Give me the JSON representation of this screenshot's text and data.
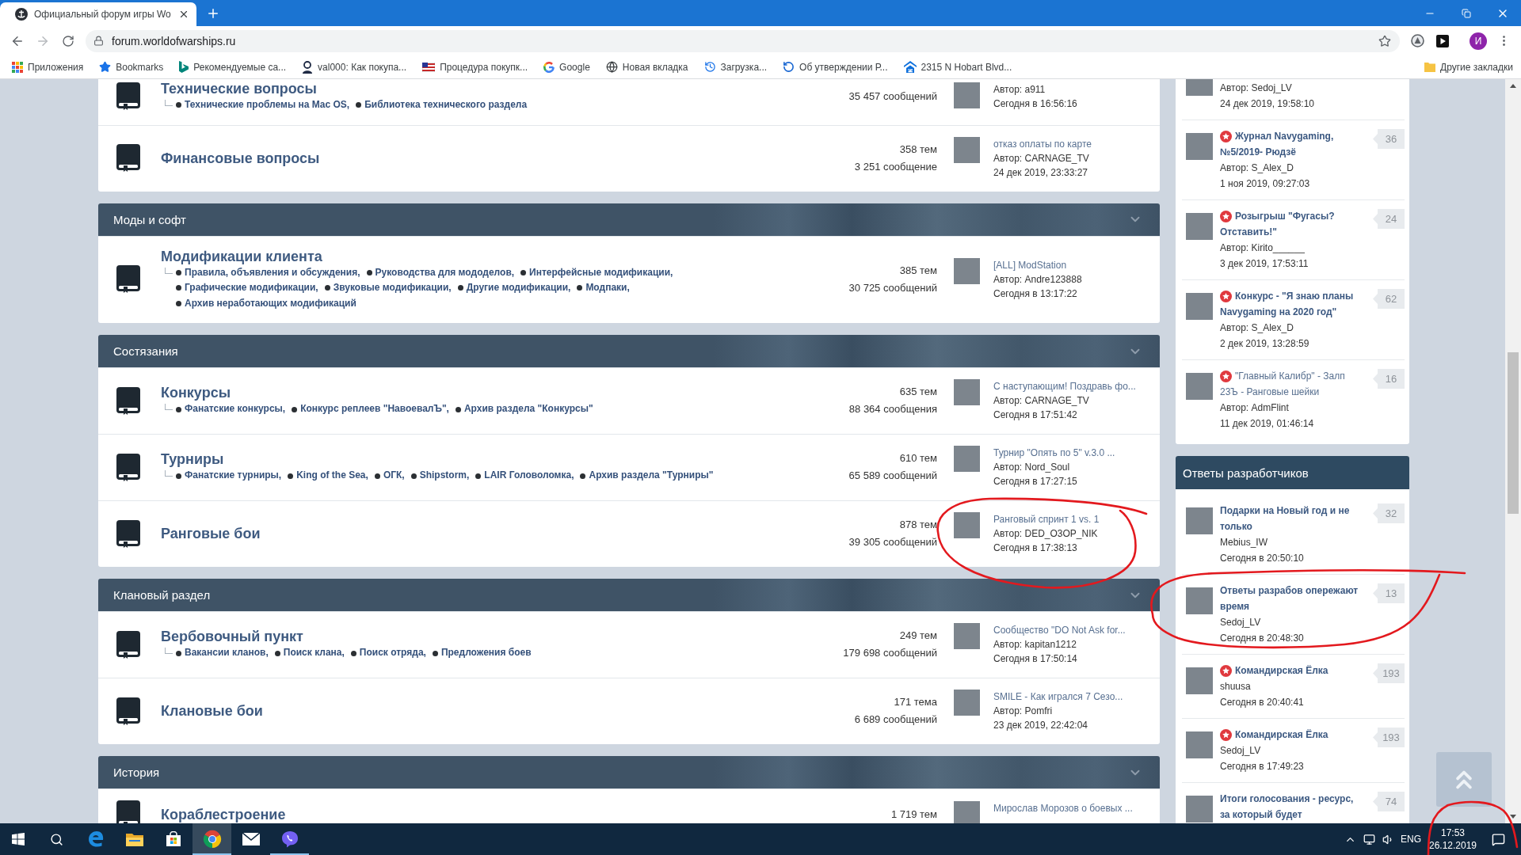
{
  "browser": {
    "tabs": [
      {
        "title": "Официальный форум игры Wo",
        "selected": true
      }
    ],
    "navigation": {
      "back_disabled": false,
      "forward_disabled": true
    },
    "address": "forum.worldofwarships.ru",
    "profile_initial": "И",
    "bookmarks": [
      {
        "label": "Приложения",
        "kind": "grid"
      },
      {
        "label": "Bookmarks",
        "kind": "star"
      },
      {
        "label": "Рекомендуемые са...",
        "kind": "logo"
      },
      {
        "label": "val000: Как покупа...",
        "kind": "person"
      },
      {
        "label": "Процедура покупк...",
        "kind": "flag"
      },
      {
        "label": "Google",
        "kind": "ring"
      },
      {
        "label": "Новая вкладка",
        "kind": "globe"
      },
      {
        "label": "Загрузка...",
        "kind": "history"
      },
      {
        "label": "Об утверждении Р...",
        "kind": "arc"
      },
      {
        "label": "2315 N Hobart Blvd...",
        "kind": "house"
      }
    ],
    "other_bookmarks": "Другие закладки"
  },
  "forum": {
    "sections": [
      {
        "forums": [
          {
            "title": "Технические вопросы",
            "subforums": [
              "Технические проблемы на Mac OS,",
              "Библиотека технического раздела"
            ],
            "posts": "35 457 сообщений",
            "last_post": {
              "author": "Автор: a911",
              "date": "Сегодня в 16:56:16",
              "circled": false
            }
          },
          {
            "title": "Финансовые вопросы",
            "topics": "358 тем",
            "posts": "3 251 сообщение",
            "last_post": {
              "topic": "отказ оплаты по карте",
              "author": "Автор: CARNAGE_TV",
              "date": "24 дек 2019, 23:33:27",
              "circled": false
            }
          }
        ]
      },
      {
        "title": "Моды и софт",
        "forums": [
          {
            "title": "Модификации клиента",
            "subforums": [
              "Правила, объявления и обсуждения,",
              "Руководства для мододелов,",
              "Интерфейсные модификации,",
              "Графические модификации,",
              "Звуковые модификации,",
              "Другие модификации,",
              "Модпаки,",
              "Архив неработающих модификаций"
            ],
            "topics": "385 тем",
            "posts": "30 725 сообщений",
            "last_post": {
              "topic": "[ALL] ModStation",
              "author": "Автор: Andre123888",
              "date": "Сегодня в 13:17:22",
              "circled": false
            }
          }
        ]
      },
      {
        "title": "Состязания",
        "forums": [
          {
            "title": "Конкурсы",
            "subforums": [
              "Фанатские конкурсы,",
              "Конкурс реплеев \"НавоевалЪ\",",
              "Архив раздела \"Конкурсы\""
            ],
            "topics": "635 тем",
            "posts": "88 364 сообщения",
            "last_post": {
              "topic": "С наступающим! Поздравь фо...",
              "author": "Автор: CARNAGE_TV",
              "date": "Сегодня в 17:51:42",
              "circled": false
            }
          },
          {
            "title": "Турниры",
            "subforums": [
              "Фанатские турниры,",
              "King of the Sea,",
              "ОГК,",
              "Shipstorm,",
              "LAIR Головоломка,",
              "Архив раздела \"Турниры\""
            ],
            "topics": "610 тем",
            "posts": "65 589 сообщений",
            "last_post": {
              "topic": "Турнир \"Опять по 5\" v.3.0 ...",
              "author": "Автор: Nord_Soul",
              "date": "Сегодня в 17:27:15",
              "circled": false
            }
          },
          {
            "title": "Ранговые бои",
            "topics": "878 тем",
            "posts": "39 305 сообщений",
            "last_post": {
              "topic": "Ранговый спринт 1 vs. 1",
              "author": "Автор: DED_O3OP_NIK",
              "date": "Сегодня в 17:38:13",
              "circled": true
            }
          }
        ]
      },
      {
        "title": "Клановый раздел",
        "forums": [
          {
            "title": "Вербовочный пункт",
            "subforums": [
              "Вакансии кланов,",
              "Поиск клана,",
              "Поиск отряда,",
              "Предложения боев"
            ],
            "topics": "249 тем",
            "posts": "179 698 сообщений",
            "last_post": {
              "topic": "Сообщество \"DO Not Ask for...",
              "author": "Автор: kapitan1212",
              "date": "Сегодня в 17:50:14",
              "circled": false
            }
          },
          {
            "title": "Клановые бои",
            "topics": "171 тема",
            "posts": "6 689 сообщений",
            "last_post": {
              "topic": "SMILE - Как игрался 7 Сезо...",
              "author": "Автор: Pomfri",
              "date": "23 дек 2019, 22:42:04",
              "circled": false
            }
          }
        ]
      },
      {
        "title": "История",
        "forums": [
          {
            "title": "Кораблестроение",
            "topics": "1 719 тем",
            "last_post": {
              "topic": "Мирослав Морозов о боевых ...",
              "circled": false
            }
          }
        ]
      }
    ]
  },
  "sidebar": {
    "blocks": [
      {
        "items": [
          {
            "author": "Автор: Sedoj_LV",
            "date": "24 дек 2019, 19:58:10",
            "circled": false
          },
          {
            "title": "Журнал Navygaming, №5/2019- Рюдзё",
            "featured": true,
            "unread": true,
            "author": "Автор: S_Alex_D",
            "date": "1 ноя 2019, 09:27:03",
            "count": "36",
            "circled": false
          },
          {
            "title": "Розыгрыш \"Фугасы? Отставить!\"",
            "featured": true,
            "unread": true,
            "author": "Автор: Kirito______",
            "date": "3 дек 2019, 17:53:11",
            "count": "24",
            "circled": false
          },
          {
            "title": "Конкурс - \"Я знаю планы Navygaming на 2020 год\"",
            "featured": true,
            "unread": true,
            "author": "Автор: S_Alex_D",
            "date": "2 дек 2019, 13:28:59",
            "count": "62",
            "circled": false
          },
          {
            "title": "\"Главный Калибр\" - Залп 23Ъ - Ранговые шейки",
            "featured": true,
            "unread": false,
            "author": "Автор: AdmFlint",
            "date": "11 дек 2019, 01:46:14",
            "count": "16",
            "circled": false
          }
        ]
      },
      {
        "title": "Ответы разработчиков",
        "items": [
          {
            "title": "Подарки на Новый год и не только",
            "featured": false,
            "unread": true,
            "author": "Mebius_IW",
            "date": "Сегодня в 20:50:10",
            "count": "32",
            "circled": false
          },
          {
            "title": "Ответы разрабов опережают время",
            "featured": false,
            "unread": true,
            "author": "Sedoj_LV",
            "date": "Сегодня в 20:48:30",
            "count": "13",
            "circled": true
          },
          {
            "title": "Командирская Ёлка",
            "featured": true,
            "unread": true,
            "author": "shuusa",
            "date": "Сегодня в 20:40:41",
            "count": "193",
            "circled": false
          },
          {
            "title": "Командирская Ёлка",
            "featured": true,
            "unread": true,
            "author": "Sedoj_LV",
            "date": "Сегодня в 17:49:23",
            "count": "193",
            "circled": false
          },
          {
            "title": "Итоги голосования - ресурс, за который будет",
            "featured": false,
            "unread": true,
            "count": "74",
            "circled": false
          }
        ]
      }
    ]
  },
  "taskbar": {
    "apps": [
      {
        "kind": "e",
        "running": false,
        "selected": false
      },
      {
        "kind": "folder",
        "running": false,
        "selected": false
      },
      {
        "kind": "bag",
        "running": false,
        "selected": false
      },
      {
        "kind": "wheel",
        "running": true,
        "selected": true
      },
      {
        "kind": "envelope",
        "running": false,
        "selected": false
      },
      {
        "kind": "phone",
        "running": true,
        "selected": false
      }
    ],
    "tray": {
      "language": "ENG",
      "time": "17:53",
      "date": "26.12.2019",
      "circled": true
    }
  }
}
